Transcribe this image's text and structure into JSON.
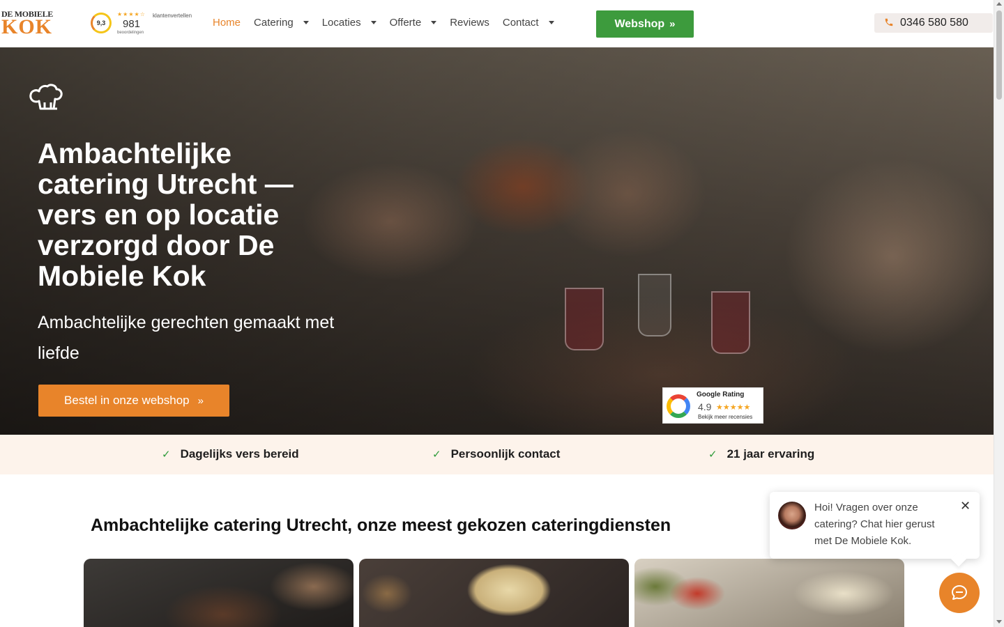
{
  "brand": {
    "logo_top": "DE MOBIELE",
    "logo_main": "KOK"
  },
  "rating": {
    "score": "9,3",
    "stars": "★★★★☆",
    "count": "981",
    "count_label": "beoordelingen",
    "brand": "klantenvertellen"
  },
  "nav": {
    "items": [
      {
        "label": "Home"
      },
      {
        "label": "Catering"
      },
      {
        "label": "Locaties"
      },
      {
        "label": "Offerte"
      },
      {
        "label": "Reviews"
      },
      {
        "label": "Contact"
      }
    ]
  },
  "header": {
    "webshop_label": "Webshop",
    "phone": "0346 580 580"
  },
  "hero": {
    "title": "Ambachtelijke catering Utrecht — vers en op locatie verzorgd door De Mobiele Kok",
    "subtitle": "Ambachtelijke gerechten gemaakt met liefde",
    "cta_label": "Bestel in onze webshop"
  },
  "google": {
    "title": "Google Rating",
    "score": "4.9",
    "stars": "★★★★★",
    "more": "Bekijk meer recensies"
  },
  "usps": [
    {
      "label": "Dagelijks vers bereid"
    },
    {
      "label": "Persoonlijk contact"
    },
    {
      "label": "21 jaar ervaring"
    }
  ],
  "section": {
    "title": "Ambachtelijke catering Utrecht, onze meest gekozen cateringdiensten"
  },
  "chat": {
    "message": "Hoi! Vragen over onze catering? Chat hier gerust met De Mobiele Kok."
  },
  "colors": {
    "accent": "#e8842a",
    "webshop_green": "#3d9b3d",
    "usp_bg": "#fdf3eb",
    "check_green": "#2e9b3a"
  }
}
